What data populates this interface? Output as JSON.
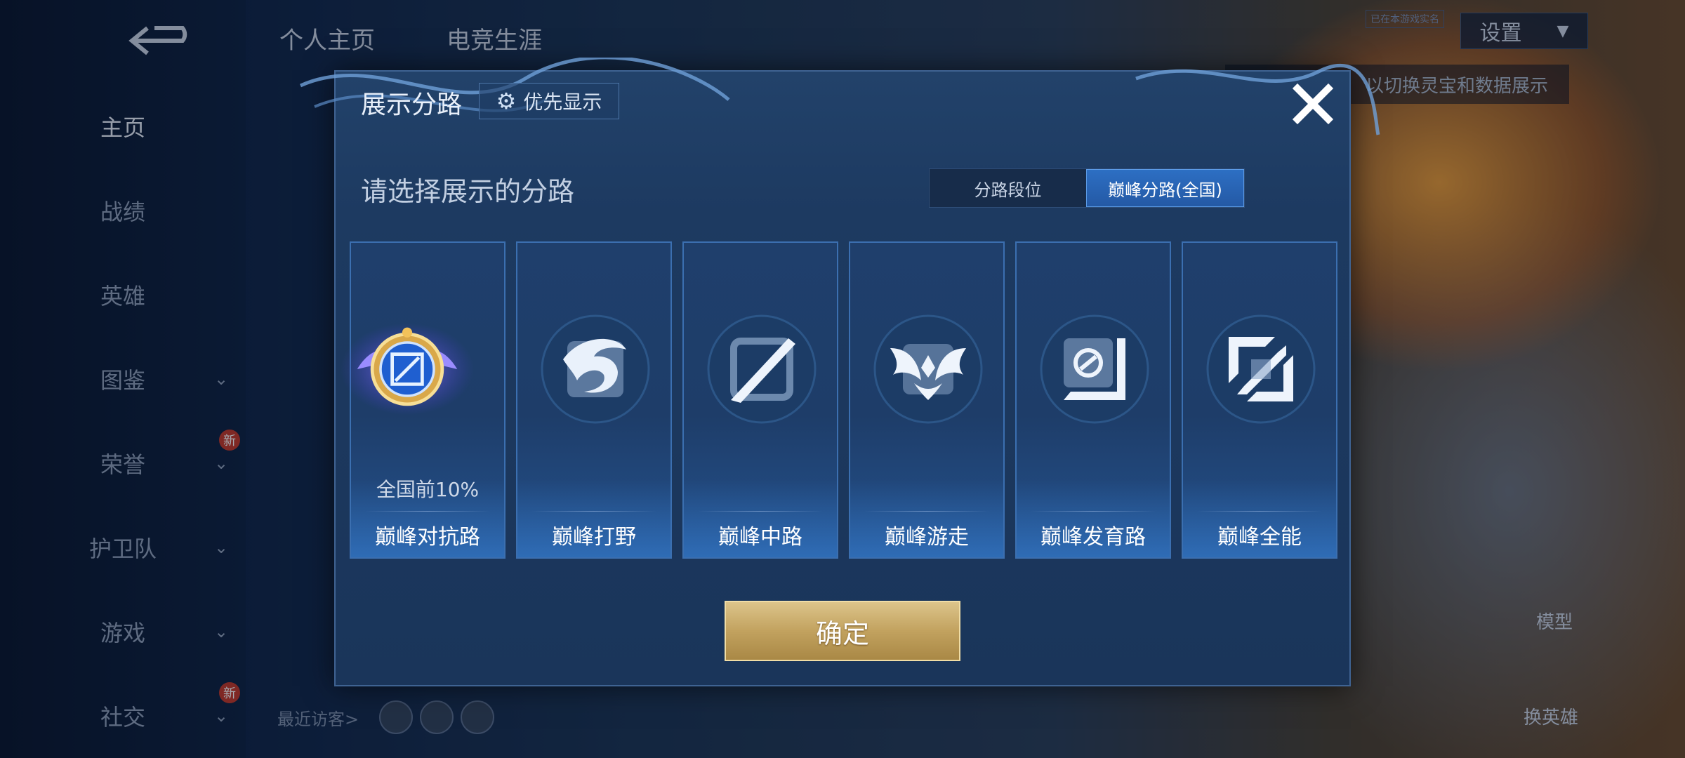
{
  "background": {
    "top_tabs": [
      "个人主页",
      "电竞生涯"
    ],
    "settings": {
      "label": "设置",
      "note": "已在本游戏实名"
    },
    "tip": "以切换灵宝和数据展示",
    "sidebar": [
      {
        "label": "主页",
        "active": true,
        "chevron": false,
        "new": false
      },
      {
        "label": "战绩",
        "active": false,
        "chevron": false,
        "new": false
      },
      {
        "label": "英雄",
        "active": false,
        "chevron": false,
        "new": false
      },
      {
        "label": "图鉴",
        "active": false,
        "chevron": true,
        "new": false
      },
      {
        "label": "荣誉",
        "active": false,
        "chevron": true,
        "new": true
      },
      {
        "label": "护卫队",
        "active": false,
        "chevron": true,
        "new": false
      },
      {
        "label": "游戏",
        "active": false,
        "chevron": true,
        "new": false
      },
      {
        "label": "社交",
        "active": false,
        "chevron": true,
        "new": true
      }
    ],
    "new_badge": "新",
    "visitors_label": "最近访客>",
    "right_labels": [
      "模型",
      "换英雄"
    ]
  },
  "modal": {
    "title": "展示分路",
    "priority_label": "优先显示",
    "prompt": "请选择展示的分路",
    "segments": [
      {
        "label": "分路段位",
        "selected": false
      },
      {
        "label": "巅峰分路(全国)",
        "selected": true
      }
    ],
    "lanes": [
      {
        "label": "巅峰对抗路",
        "rank": "全国前10%",
        "icon": "clash-lane-badge-icon",
        "selected": true
      },
      {
        "label": "巅峰打野",
        "rank": "",
        "icon": "jungle-dragon-icon",
        "selected": false
      },
      {
        "label": "巅峰中路",
        "rank": "",
        "icon": "mid-lane-slash-icon",
        "selected": false
      },
      {
        "label": "巅峰游走",
        "rank": "",
        "icon": "roam-wings-icon",
        "selected": false
      },
      {
        "label": "巅峰发育路",
        "rank": "",
        "icon": "farm-lane-icon",
        "selected": false
      },
      {
        "label": "巅峰全能",
        "rank": "",
        "icon": "all-round-icon",
        "selected": false
      }
    ],
    "confirm_label": "确定"
  },
  "colors": {
    "accent_blue": "#2d6fc3",
    "gold_button": "#c2a25f",
    "panel": "#1d3a61"
  }
}
